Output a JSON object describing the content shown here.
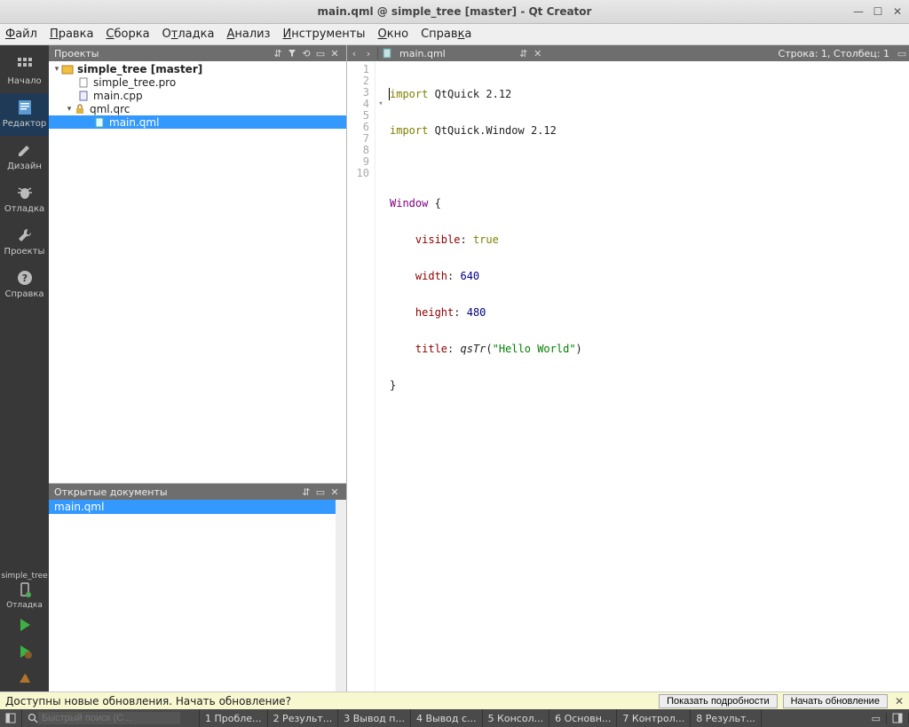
{
  "window": {
    "title": "main.qml @ simple_tree [master] - Qt Creator"
  },
  "menu": [
    "Файл",
    "Правка",
    "Сборка",
    "Отладка",
    "Анализ",
    "Инструменты",
    "Окно",
    "Справка"
  ],
  "leftbar": {
    "start": "Начало",
    "editor": "Редактор",
    "design": "Дизайн",
    "debug": "Отладка",
    "projects": "Проекты",
    "help": "Справка",
    "projname": "simple_tree",
    "mode": "Отладка"
  },
  "projects": {
    "title": "Проекты",
    "tree": {
      "root": "simple_tree [master]",
      "pro": "simple_tree.pro",
      "maincpp": "main.cpp",
      "qrc": "qml.qrc",
      "mainqml": "main.qml"
    }
  },
  "opendocs": {
    "title": "Открытые документы",
    "items": [
      "main.qml"
    ]
  },
  "editor": {
    "filename": "main.qml",
    "position": "Строка: 1, Столбец: 1",
    "lines": {
      "count": 10,
      "l1a": "import",
      "l1b": " QtQuick 2.12",
      "l2a": "import",
      "l2b": " QtQuick.Window 2.12",
      "l4a": "Window",
      "l4b": " {",
      "l5a": "    ",
      "l5b": "visible",
      "l5c": ": ",
      "l5d": "true",
      "l6a": "    ",
      "l6b": "width",
      "l6c": ": ",
      "l6d": "640",
      "l7a": "    ",
      "l7b": "height",
      "l7c": ": ",
      "l7d": "480",
      "l8a": "    ",
      "l8b": "title",
      "l8c": ": ",
      "l8d": "qsTr",
      "l8e": "(",
      "l8f": "\"Hello World\"",
      "l8g": ")",
      "l9": "}"
    }
  },
  "notify": {
    "msg": "Доступны новые обновления. Начать обновление?",
    "details": "Показать подробности",
    "start": "Начать обновление"
  },
  "status": {
    "search_placeholder": "Быстрый поиск (С...",
    "tabs": [
      "1  Пробле...",
      "2  Результ...",
      "3  Вывод п...",
      "4  Вывод с...",
      "5  Консол...",
      "6  Основн...",
      "7  Контрол...",
      "8  Результ..."
    ]
  }
}
